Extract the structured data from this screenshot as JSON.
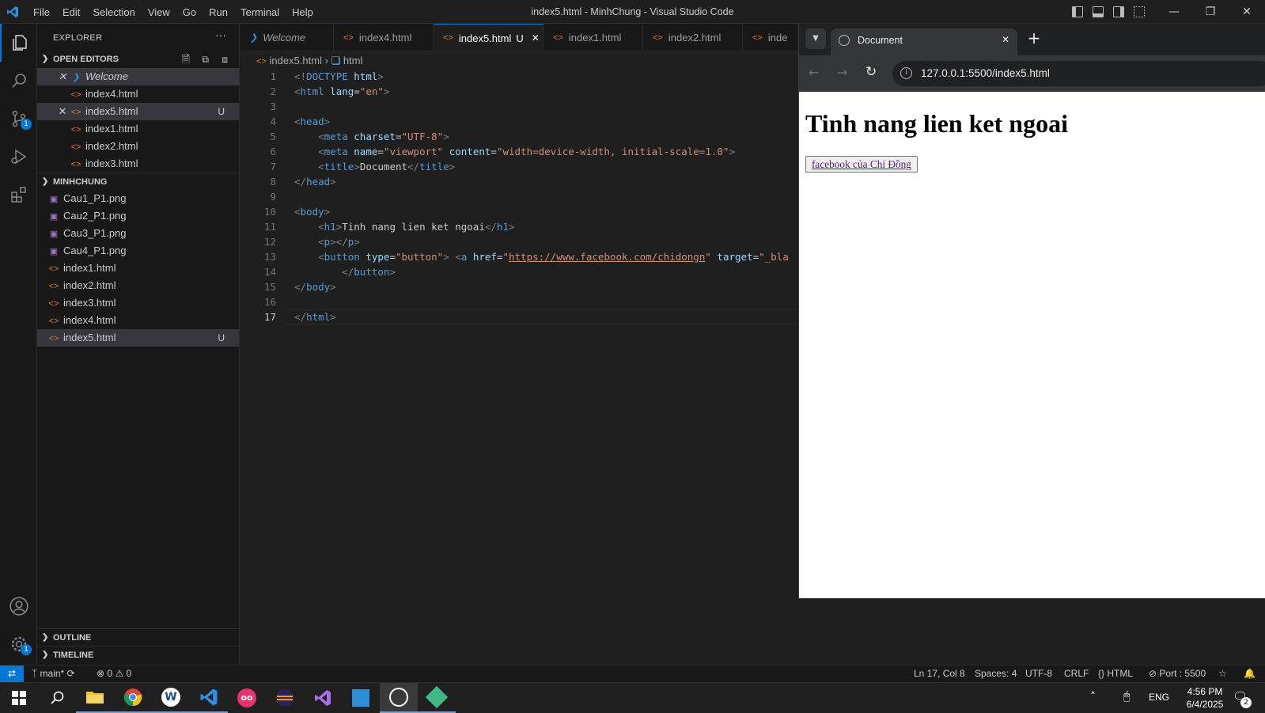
{
  "window": {
    "title": "index5.html - MinhChung - Visual Studio Code"
  },
  "menu": [
    "File",
    "Edit",
    "Selection",
    "View",
    "Go",
    "Run",
    "Terminal",
    "Help"
  ],
  "activity": {
    "source_control_badge": "1",
    "settings_badge": "1"
  },
  "sidebar": {
    "title": "EXPLORER",
    "open_editors_label": "OPEN EDITORS",
    "open_editors": [
      {
        "label": "Welcome",
        "U": ""
      },
      {
        "label": "index4.html",
        "U": ""
      },
      {
        "label": "index5.html",
        "U": "U"
      },
      {
        "label": "index1.html",
        "U": ""
      },
      {
        "label": "index2.html",
        "U": ""
      },
      {
        "label": "index3.html",
        "U": ""
      }
    ],
    "folder_label": "MINHCHUNG",
    "files": [
      {
        "label": "Cau1_P1.png",
        "U": ""
      },
      {
        "label": "Cau2_P1.png",
        "U": ""
      },
      {
        "label": "Cau3_P1.png",
        "U": ""
      },
      {
        "label": "Cau4_P1.png",
        "U": ""
      },
      {
        "label": "index1.html",
        "U": ""
      },
      {
        "label": "index2.html",
        "U": ""
      },
      {
        "label": "index3.html",
        "U": ""
      },
      {
        "label": "index4.html",
        "U": ""
      },
      {
        "label": "index5.html",
        "U": "U"
      }
    ],
    "outline_label": "OUTLINE",
    "timeline_label": "TIMELINE"
  },
  "tabs": [
    {
      "label": "Welcome",
      "mod": ""
    },
    {
      "label": "index4.html",
      "mod": ""
    },
    {
      "label": "index5.html",
      "mod": "U"
    },
    {
      "label": "index1.html",
      "mod": ""
    },
    {
      "label": "index2.html",
      "mod": ""
    },
    {
      "label": "inde",
      "mod": ""
    }
  ],
  "breadcrumb": {
    "file": "index5.html",
    "symbol": "html"
  },
  "code": {
    "line_numbers": [
      "1",
      "2",
      "3",
      "4",
      "5",
      "6",
      "7",
      "8",
      "9",
      "10",
      "11",
      "12",
      "13",
      "14",
      "15",
      "16",
      "17"
    ],
    "l1": {
      "a": "<!",
      "b": "DOCTYPE",
      "c": " html",
      "d": ">"
    },
    "l2": {
      "a": "<",
      "b": "html",
      "c": " lang",
      "d": "=",
      "e": "\"en\"",
      "f": ">"
    },
    "l4": {
      "a": "<",
      "b": "head",
      "c": ">"
    },
    "l5": {
      "a": "    <",
      "b": "meta",
      "c": " charset",
      "d": "=",
      "e": "\"UTF-8\"",
      "f": ">"
    },
    "l6": {
      "a": "    <",
      "b": "meta",
      "c": " name",
      "d": "=",
      "e": "\"viewport\"",
      "f": " content",
      "g": "=",
      "h": "\"width=device-width, initial-scale=1.0\"",
      "i": ">"
    },
    "l7": {
      "a": "    <",
      "b": "title",
      "c": ">",
      "d": "Document",
      "e": "</",
      "f": "title",
      "g": ">"
    },
    "l8": {
      "a": "</",
      "b": "head",
      "c": ">"
    },
    "l10": {
      "a": "<",
      "b": "body",
      "c": ">"
    },
    "l11": {
      "a": "    <",
      "b": "h1",
      "c": ">",
      "d": "Tinh nang lien ket ngoai",
      "e": "</",
      "f": "h1",
      "g": ">"
    },
    "l12": {
      "a": "    <",
      "b": "p",
      "c": "></",
      "d": "p",
      "e": ">"
    },
    "l13": {
      "a": "    <",
      "b": "button",
      "c": " type",
      "d": "=",
      "e": "\"button\"",
      "f": "> <",
      "g": "a",
      "h": " href",
      "i": "=",
      "j": "\"",
      "k": "https://www.facebook.com/chidongn",
      "l": "\"",
      "m": " target",
      "n": "=",
      "o": "\"_bla"
    },
    "l14": {
      "a": "        </",
      "b": "button",
      "c": ">"
    },
    "l15": {
      "a": "</",
      "b": "body",
      "c": ">"
    },
    "l17": {
      "a": "</",
      "b": "html",
      "c": ">"
    }
  },
  "browser": {
    "tab_title": "Document",
    "url": "127.0.0.1:5500/index5.html",
    "heading": "Tinh nang lien ket ngoai",
    "link_text": "facebook của Chí Đồng"
  },
  "status": {
    "branch": "main*",
    "errors": "0",
    "warnings": "0",
    "position": "Ln 17, Col 8",
    "spaces": "Spaces: 4",
    "encoding": "UTF-8",
    "eol": "CRLF",
    "language": "HTML",
    "port": "Port : 5500"
  },
  "taskbar": {
    "lang": "ENG",
    "time": "4:56 PM",
    "date": "6/4/2025",
    "notif_count": "2"
  },
  "colors": {
    "accent": "#0078d4",
    "html_icon": "#e37933",
    "png_icon": "#a074c4"
  }
}
